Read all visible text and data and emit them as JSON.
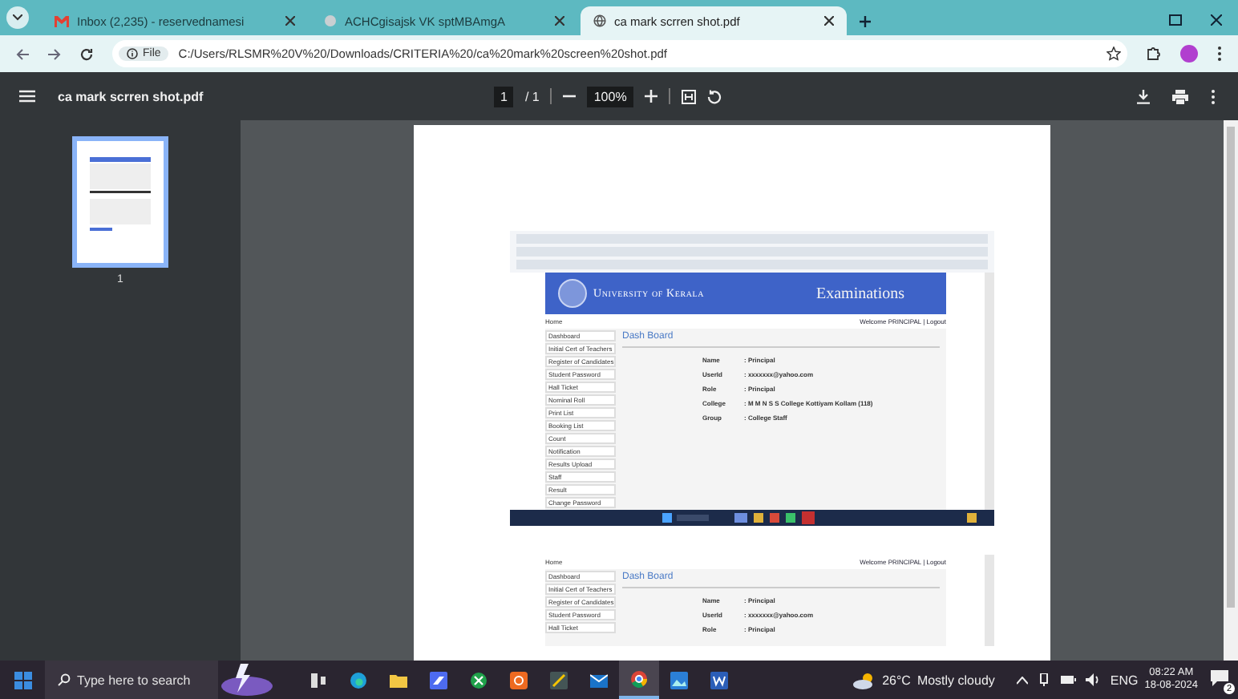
{
  "browser": {
    "tabs": [
      {
        "kind": "mail",
        "title": "Inbox (2,235) - reservednamesi",
        "selected": false
      },
      {
        "kind": "web",
        "title": "ACHCgisajsk VK sptMBAmgA",
        "selected": false
      },
      {
        "kind": "pdf",
        "title": "ca mark scrren shot.pdf",
        "selected": true
      }
    ],
    "address": {
      "chip": "File",
      "url": "C:/Users/RLSMR%20V%20/Downloads/CRITERIA%20/ca%20mark%20screen%20shot.pdf"
    }
  },
  "pdf_toolbar": {
    "filename": "ca mark scrren shot.pdf",
    "page": "1",
    "page_total": "/ 1",
    "zoom": "100%"
  },
  "thumbnails": [
    {
      "label": "1",
      "selected": true
    }
  ],
  "document": {
    "captures": [
      {
        "kind": "full",
        "university": "University of Kerala",
        "section": "Examinations",
        "home": "Home",
        "welcome": "Welcome PRINCIPAL | Logout",
        "heading": "Dash Board",
        "menu": [
          "Dashboard",
          "Initial Cert of Teachers",
          "Register of Candidates",
          "Student Password",
          "Hall Ticket",
          "Nominal Roll",
          "Print List",
          "Booking List",
          "Count",
          "Notification",
          "Results Upload",
          "Staff",
          "Result",
          "Change Password"
        ],
        "fields": [
          {
            "label": "Name",
            "value": ": Principal"
          },
          {
            "label": "UserId",
            "value": ": xxxxxxx@yahoo.com"
          },
          {
            "label": "Role",
            "value": ": Principal"
          },
          {
            "label": "College",
            "value": ": M M N S S College Kottiyam Kollam (118)"
          },
          {
            "label": "Group",
            "value": ": College Staff"
          }
        ]
      },
      {
        "kind": "partial",
        "home": "Home",
        "welcome": "Welcome PRINCIPAL | Logout",
        "heading": "Dash Board",
        "menu": [
          "Dashboard",
          "Initial Cert of Teachers",
          "Register of Candidates",
          "Student Password",
          "Hall Ticket"
        ],
        "fields": [
          {
            "label": "Name",
            "value": ": Principal"
          },
          {
            "label": "UserId",
            "value": ": xxxxxxx@yahoo.com"
          },
          {
            "label": "Role",
            "value": ": Principal"
          }
        ]
      }
    ]
  },
  "taskbar": {
    "search": {
      "placeholder": "Type here to search"
    },
    "apps": [
      {
        "kind": "taskview",
        "selected": false
      },
      {
        "kind": "edge",
        "selected": false
      },
      {
        "kind": "folder",
        "selected": false
      },
      {
        "kind": "teams",
        "selected": false
      },
      {
        "kind": "xbox",
        "selected": false
      },
      {
        "kind": "orange",
        "selected": false
      },
      {
        "kind": "snip",
        "selected": false
      },
      {
        "kind": "mail",
        "selected": false
      },
      {
        "kind": "chrome",
        "selected": true
      },
      {
        "kind": "photos",
        "selected": false
      },
      {
        "kind": "word",
        "selected": false
      }
    ],
    "weather": {
      "temp": "26°C",
      "condition": "Mostly cloudy"
    },
    "language": "ENG",
    "time": "08:22 AM",
    "date": "18-08-2024",
    "notifications": "2"
  }
}
